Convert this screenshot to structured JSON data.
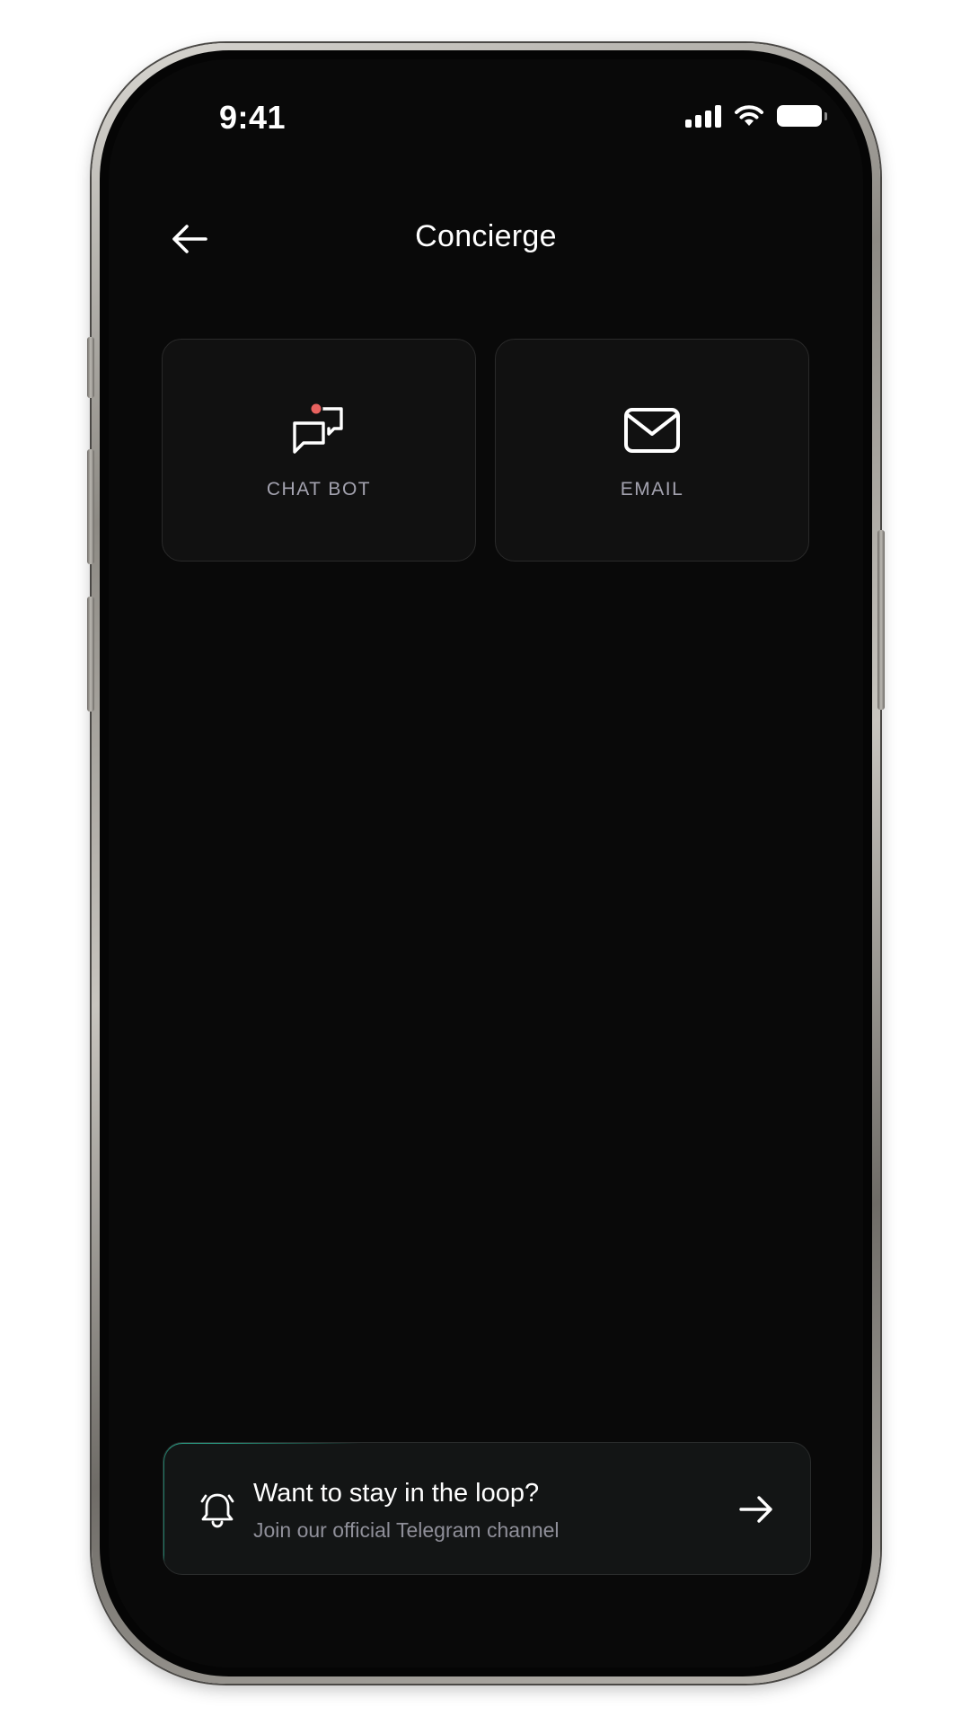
{
  "status_bar": {
    "time": "9:41",
    "icons": [
      "signal-icon",
      "wifi-icon",
      "battery-icon"
    ]
  },
  "header": {
    "title": "Concierge",
    "back_icon": "arrow-left-icon"
  },
  "options": [
    {
      "label": "CHAT BOT",
      "icon": "chat-bubbles-icon",
      "has_notification_dot": true
    },
    {
      "label": "EMAIL",
      "icon": "envelope-icon",
      "has_notification_dot": false
    }
  ],
  "banner": {
    "title": "Want to stay in the loop?",
    "subtitle": "Join our official Telegram channel",
    "icon": "bell-icon",
    "action_icon": "arrow-right-icon"
  },
  "colors": {
    "background": "#090909",
    "card": "#111111",
    "label": "#a4a3b0",
    "notification_dot": "#e8625f",
    "banner_accent": "#2aa58a"
  }
}
